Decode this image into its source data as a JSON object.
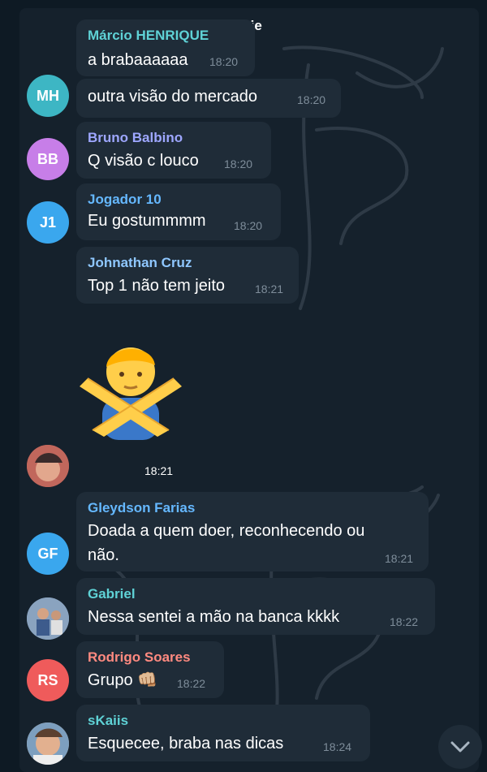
{
  "date_label": "Hoje",
  "messages": [
    {
      "sender": "Márcio HENRIQUE",
      "text": "a brabaaaaaa",
      "time": "18:20",
      "color": "#5fd2d6"
    },
    {
      "text": "outra visão do mercado",
      "time": "18:20",
      "avatar": "MH",
      "avatar_color": "#3db6c4"
    },
    {
      "sender": "Bruno Balbino",
      "text": "Q visão c louco",
      "time": "18:20",
      "avatar": "BB",
      "avatar_color": "#c77ee8",
      "color": "#9ea7ff"
    },
    {
      "sender": "Jogador 10",
      "text": "Eu gostummmm",
      "time": "18:20",
      "avatar": "J1",
      "avatar_color": "#3aa7ee",
      "color": "#65b8ff"
    },
    {
      "sender": "Johnathan Cruz",
      "text": "Top 1 não tem jeito",
      "time": "18:21",
      "color": "#8fc7ff"
    },
    {
      "sticker": "man-gesturing-no",
      "time": "18:21"
    },
    {
      "sender": "Gleydson Farias",
      "text_lines": [
        "Doada a quem doer, reconhecendo ou",
        "não."
      ],
      "time": "18:21",
      "avatar": "GF",
      "avatar_color": "#3aa7ee",
      "color": "#65b8ff"
    },
    {
      "sender": "Gabriel",
      "text": "Nessa sentei a mão na banca kkkk",
      "time": "18:22",
      "color": "#5fd2d6"
    },
    {
      "sender": "Rodrigo Soares",
      "text": "Grupo 👊🏼",
      "time": "18:22",
      "avatar": "RS",
      "avatar_color": "#ef5b5b",
      "color": "#ff8a80"
    },
    {
      "sender": "sKaiis",
      "text": "Esquecee, braba nas dicas",
      "time": "18:24",
      "color": "#5fd2d6"
    }
  ],
  "icons": {
    "scroll_down": "chevron-down-icon"
  }
}
